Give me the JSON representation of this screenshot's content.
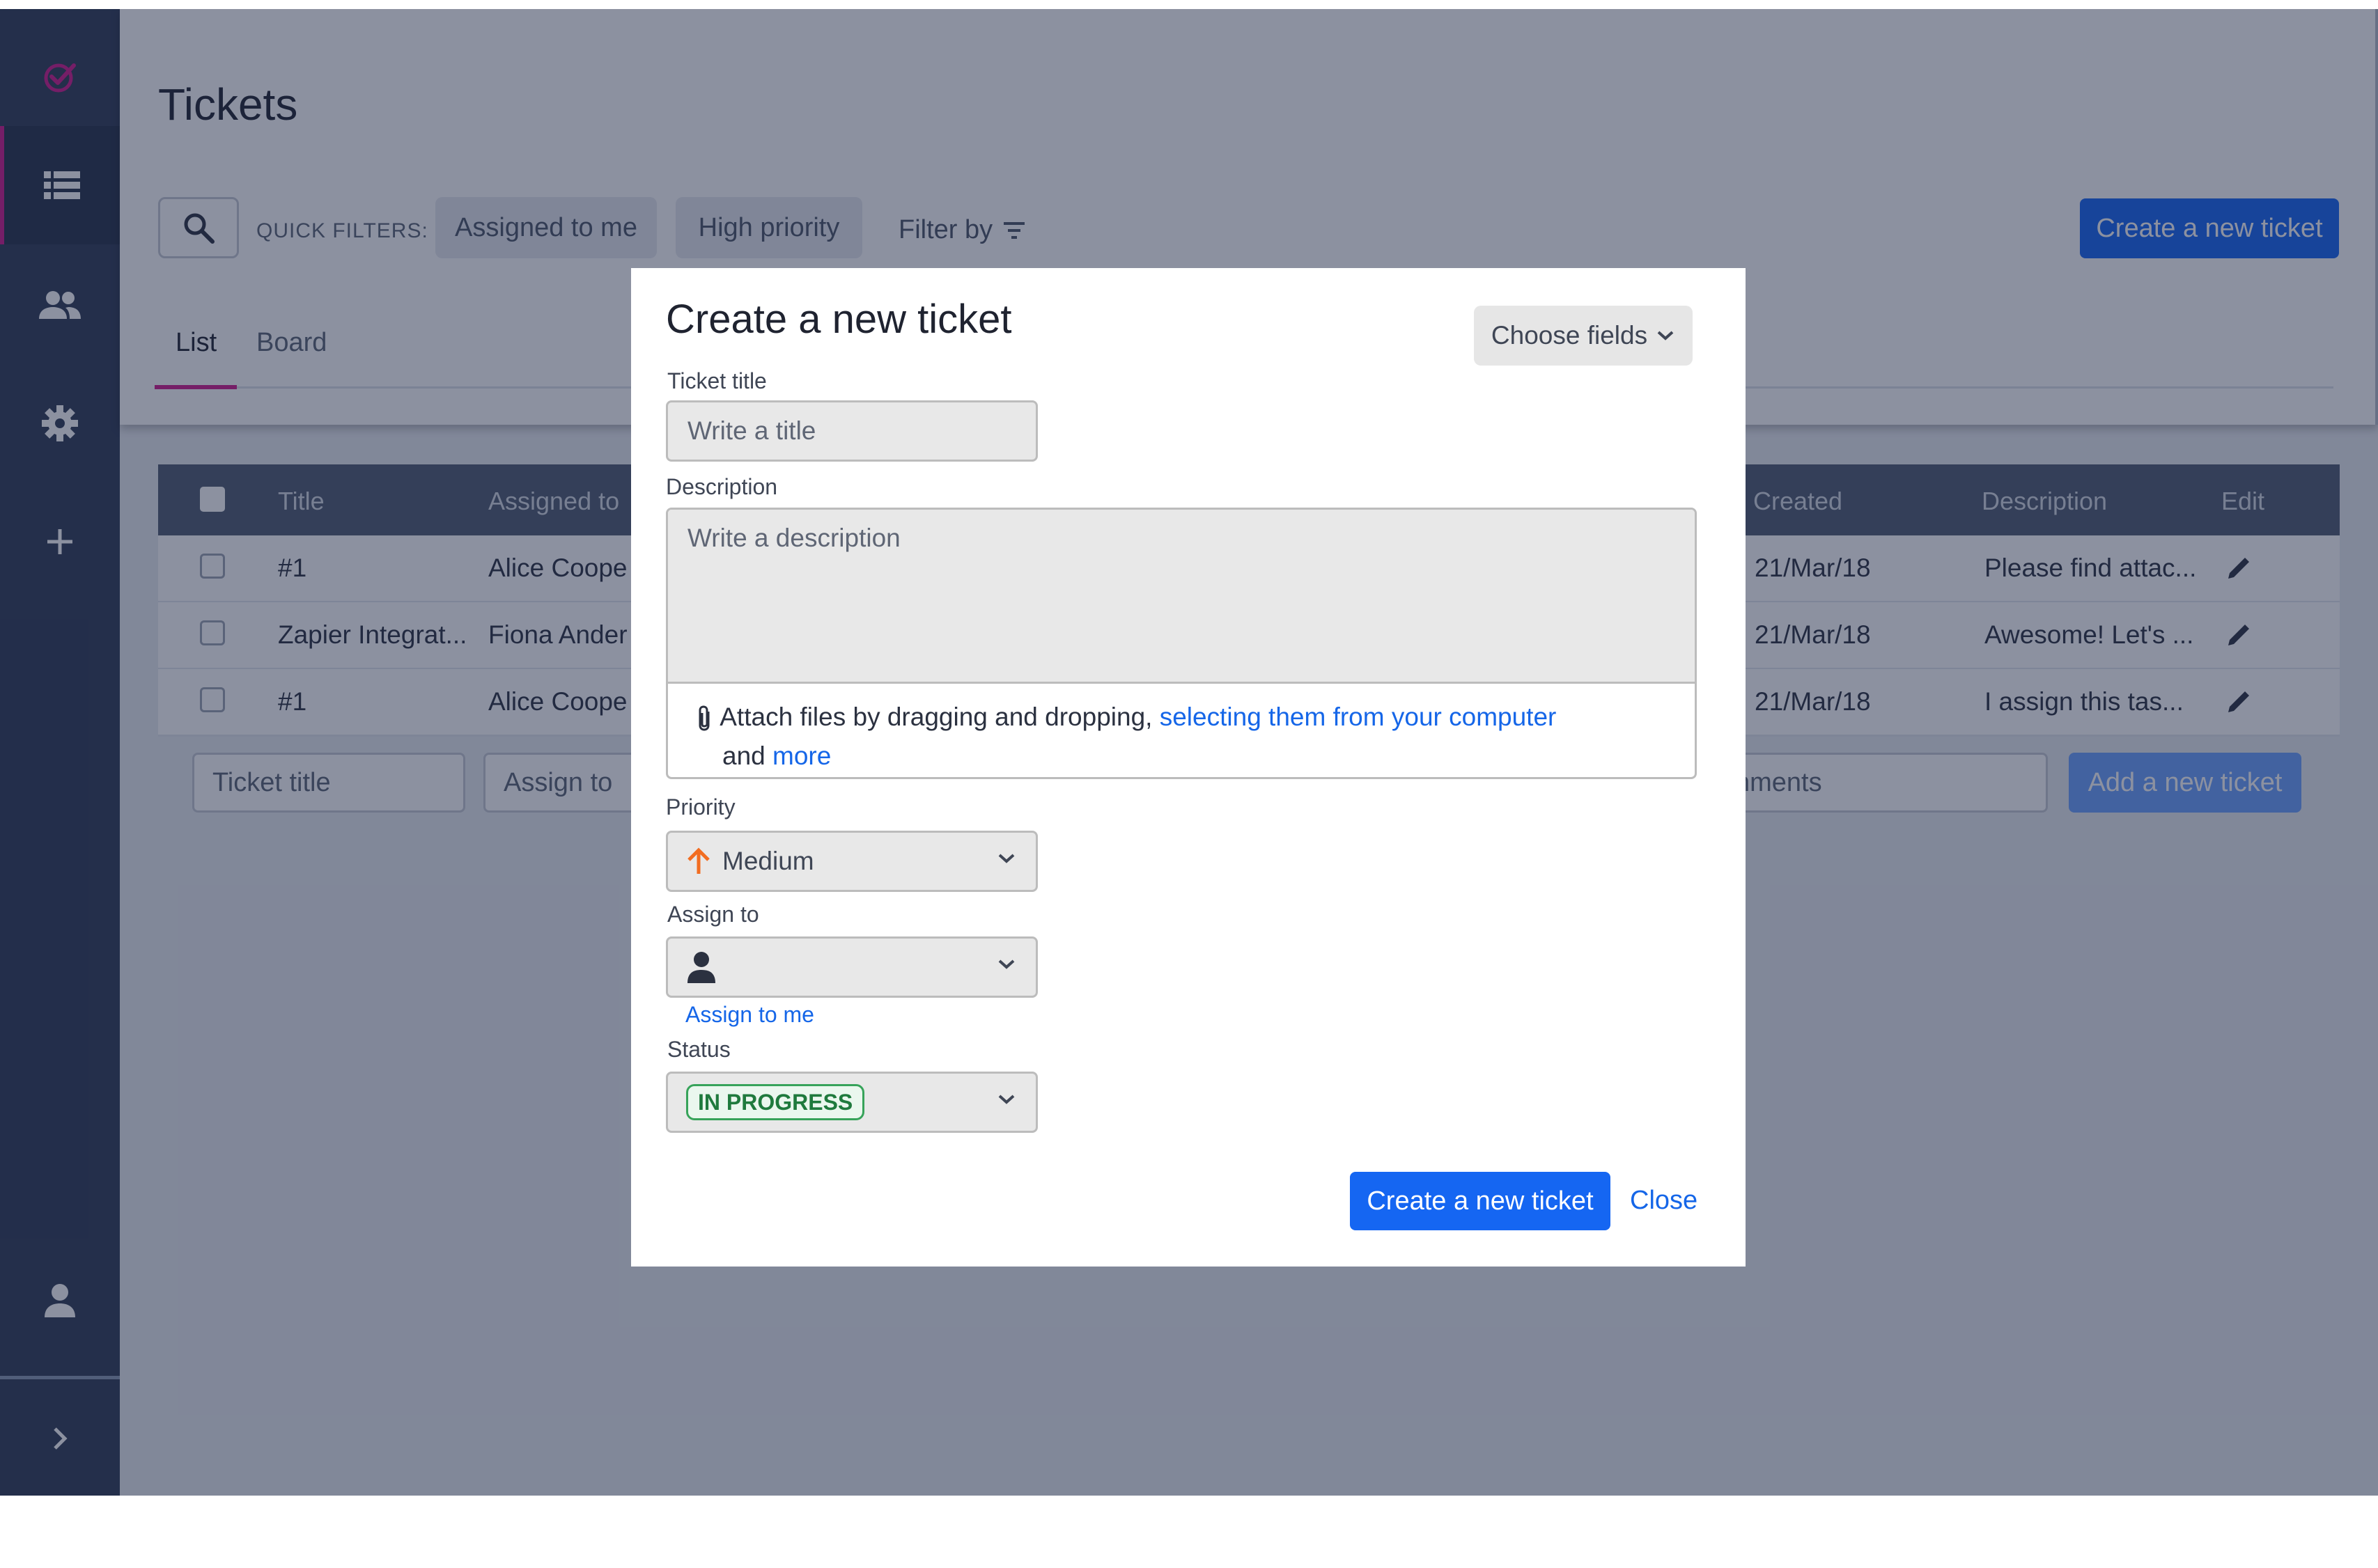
{
  "page": {
    "title": "Tickets"
  },
  "sidebar": {
    "items": [
      "logo-icon",
      "tickets-icon",
      "people-icon",
      "gear-icon",
      "plus-icon",
      "user-icon",
      "chevron-right-icon"
    ]
  },
  "toolbar": {
    "quick_filters_label": "QUICK FILTERS:",
    "chips": [
      "Assigned to me",
      "High priority"
    ],
    "filter_by": "Filter by",
    "create_button": "Create a new ticket"
  },
  "tabs": [
    "List",
    "Board"
  ],
  "table": {
    "headers": [
      "Title",
      "Assigned to",
      "Created",
      "Description",
      "Edit"
    ],
    "rows": [
      {
        "title": "#1",
        "assigned": "Alice Coope",
        "created": "21/Mar/18",
        "description": "Please find attac..."
      },
      {
        "title": "Zapier Integrat...",
        "assigned": "Fiona Ander",
        "created": "21/Mar/18",
        "description": "Awesome! Let's ..."
      },
      {
        "title": "#1",
        "assigned": "Alice Coope",
        "created": "21/Mar/18",
        "description": "I assign this tas..."
      }
    ],
    "new_row": {
      "title_placeholder": "Ticket title",
      "assign_placeholder": "Assign to",
      "comments_placeholder": "nments",
      "add_button": "Add a new ticket"
    }
  },
  "modal": {
    "title": "Create a new ticket",
    "choose_fields": "Choose fields",
    "ticket_title_label": "Ticket title",
    "ticket_title_placeholder": "Write a title",
    "description_label": "Description",
    "description_placeholder": "Write a description",
    "attach_text": "Attach files by dragging and dropping,",
    "attach_link": "selecting them from your computer",
    "attach_and": "and",
    "attach_more": "more",
    "priority_label": "Priority",
    "priority_value": "Medium",
    "assign_label": "Assign to",
    "assign_to_me": "Assign to me",
    "status_label": "Status",
    "status_value": "IN PROGRESS",
    "create_button": "Create a new ticket",
    "close_button": "Close"
  },
  "colors": {
    "accent": "#1566f2",
    "brand": "#d1198c",
    "priority": "#f26d21",
    "status": "#37a35a",
    "sidebar": "#2e3a55"
  }
}
